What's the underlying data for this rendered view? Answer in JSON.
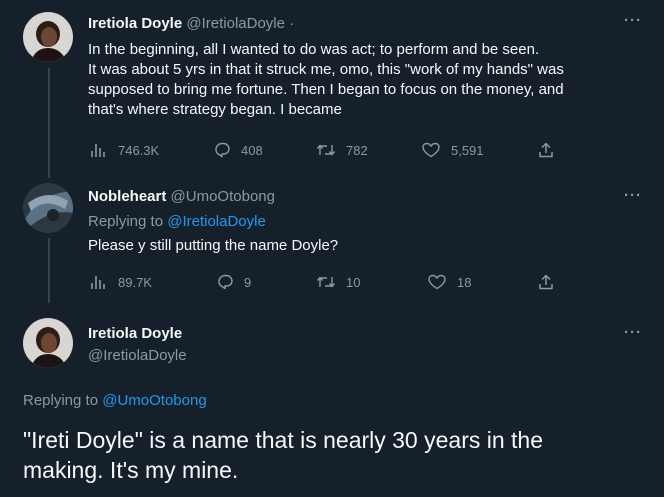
{
  "tweet1": {
    "name": "Iretiola Doyle",
    "handle": "@IretiolaDoyle",
    "dot": "·",
    "lines": [
      "In the beginning, all I wanted to do was act; to perform and be seen.",
      "It was about 5 yrs in that it struck me,  omo, this \"work of my hands\" was",
      "supposed to bring me fortune. Then I began to focus on the money, and",
      "that's where strategy began. I became"
    ],
    "views": "746.3K",
    "replies": "408",
    "retweets": "782",
    "likes": "5,591"
  },
  "tweet2": {
    "name": "Nobleheart",
    "handle": "@UmoOtobong",
    "replying_prefix": "Replying to",
    "replying_to": "@IretiolaDoyle",
    "text": "Please y still putting the name Doyle?",
    "views": "89.7K",
    "replies": "9",
    "retweets": "10",
    "likes": "18"
  },
  "tweet3": {
    "name": "Iretiola Doyle",
    "handle": "@IretiolaDoyle",
    "replying_prefix": "Replying to",
    "replying_to": "@UmoOtobong",
    "lines": [
      "\"Ireti Doyle\" is a name that is nearly 30 years in the",
      "making. It's my mine."
    ]
  },
  "more_label": "···",
  "icons": [
    "views-icon",
    "reply-icon",
    "retweet-icon",
    "like-icon",
    "share-icon",
    "more-icon"
  ],
  "colors": {
    "background": "#15202b",
    "text": "#f7f9f9",
    "muted": "#8b98a5",
    "link": "#1d9bf0"
  }
}
